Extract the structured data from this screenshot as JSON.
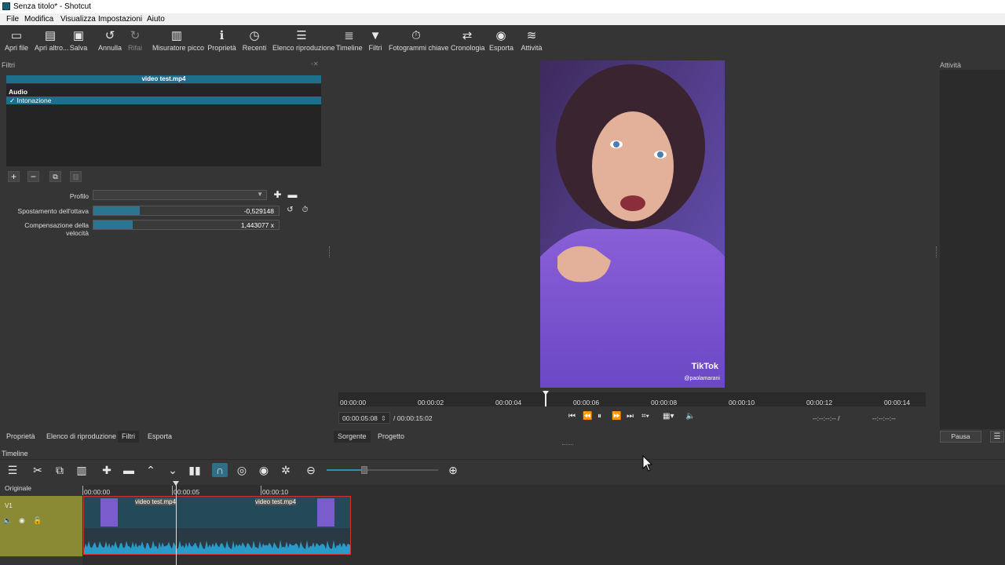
{
  "window": {
    "title": "Senza titolo* - Shotcut"
  },
  "menu": [
    "File",
    "Modifica",
    "Visualizza",
    "Impostazioni",
    "Aiuto"
  ],
  "toolbar": [
    {
      "icon": "open-file-icon",
      "label": "Apri file"
    },
    {
      "icon": "open-other-icon",
      "label": "Apri altro..."
    },
    {
      "icon": "save-icon",
      "label": "Salva"
    },
    {
      "icon": "undo-icon",
      "label": "Annulla"
    },
    {
      "icon": "redo-icon",
      "label": "Rifai"
    },
    {
      "icon": "peak-meter-icon",
      "label": "Misuratore picco"
    },
    {
      "icon": "properties-icon",
      "label": "Proprietà"
    },
    {
      "icon": "recent-icon",
      "label": "Recenti"
    },
    {
      "icon": "playlist-icon",
      "label": "Elenco riproduzione"
    },
    {
      "icon": "timeline-icon",
      "label": "Timeline"
    },
    {
      "icon": "filter-icon",
      "label": "Filtri"
    },
    {
      "icon": "keyframes-icon",
      "label": "Fotogrammi chiave"
    },
    {
      "icon": "history-icon",
      "label": "Cronologia"
    },
    {
      "icon": "export-icon",
      "label": "Esporta"
    },
    {
      "icon": "jobs-icon",
      "label": "Attività"
    }
  ],
  "filters_panel": {
    "title": "Filtri",
    "clip_name": "video test.mp4",
    "category": "Audio",
    "item_check": "✓",
    "item": "Intonazione",
    "profile_label": "Profilo",
    "profile_value": "",
    "params": [
      {
        "label": "Spostamento dell'ottava",
        "value": "-0,529148",
        "fill": 0.25
      },
      {
        "label": "Compensazione della velocità",
        "value": "1,443077 x",
        "fill": 0.21
      }
    ]
  },
  "player": {
    "watermark": "TikTok",
    "watermark_user": "@paolamarani",
    "ruler": [
      "00:00:00",
      "00:00:02",
      "00:00:04",
      "00:00:06",
      "00:00:08",
      "00:00:10",
      "00:00:12",
      "00:00:14"
    ],
    "current_time": "00:00:05:08",
    "duration": "/ 00:00:15:02",
    "in_point": "--:--:--:-- /",
    "out_point": "--:--:--:--",
    "tabs": [
      "Sorgente",
      "Progetto"
    ]
  },
  "right_panel": {
    "title": "Attività",
    "pause_button": "Pausa"
  },
  "left_tabs": [
    "Proprietà",
    "Elenco di riproduzione",
    "Filtri",
    "Esporta"
  ],
  "timeline": {
    "title": "Timeline",
    "track_header": "Originale",
    "track_name": "V1",
    "ruler": [
      "00:00:00",
      "00:00:05",
      "00:00:10"
    ],
    "clip_label_1": "video test.mp4",
    "clip_label_2": "video test.mp4"
  }
}
